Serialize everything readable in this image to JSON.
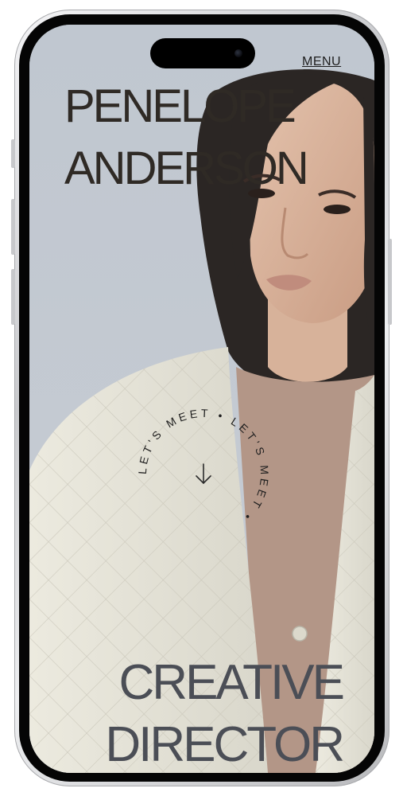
{
  "nav": {
    "menu_label": "MENU"
  },
  "hero": {
    "name_line1": "PENELOPE",
    "name_line2": "ANDERSON",
    "role_line1": "CREATIVE",
    "role_line2": "DIRECTOR"
  },
  "cta": {
    "circular_text": "LET'S MEET • LET'S MEET • ",
    "icon": "arrow-down-icon"
  },
  "colors": {
    "background": "#c4cad2",
    "name_text": "#2f2a25",
    "role_text": "#4b4e56",
    "jacket": "#e5e3d8"
  }
}
